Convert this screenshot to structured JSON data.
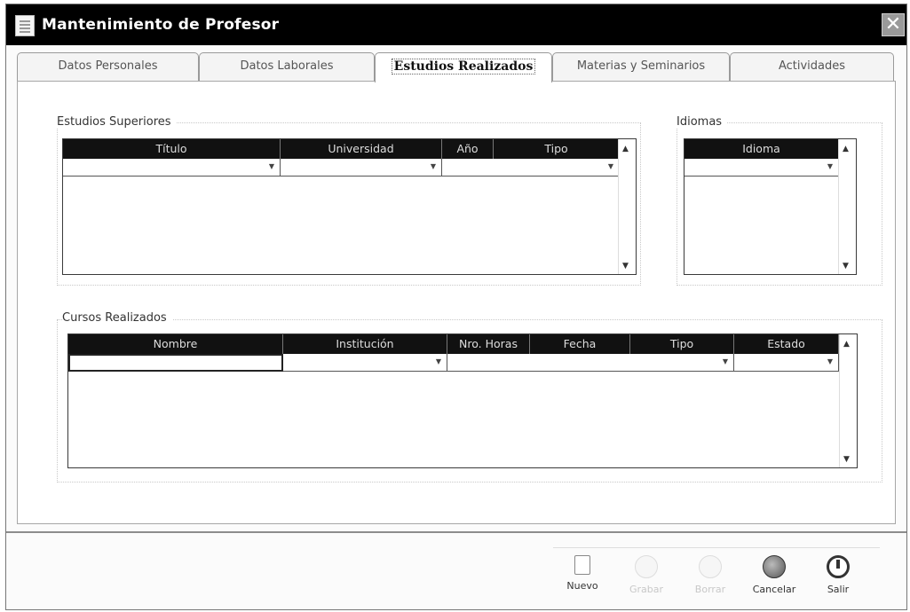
{
  "window": {
    "title": "Mantenimiento de Profesor",
    "close_symbol": "✕"
  },
  "tabs": [
    {
      "label": "Datos Personales",
      "active": false
    },
    {
      "label": "Datos Laborales",
      "active": false
    },
    {
      "label": "Estudios Realizados",
      "active": true
    },
    {
      "label": "Materias y Seminarios",
      "active": false
    },
    {
      "label": "Actividades",
      "active": false
    }
  ],
  "estudios": {
    "label": "Estudios Superiores",
    "columns": [
      "Título",
      "Universidad",
      "Año",
      "Tipo"
    ]
  },
  "idiomas": {
    "label": "Idiomas",
    "columns": [
      "Idioma"
    ]
  },
  "cursos": {
    "label": "Cursos Realizados",
    "columns": [
      "Nombre",
      "Institución",
      "Nro. Horas",
      "Fecha",
      "Tipo",
      "Estado"
    ]
  },
  "toolbar": {
    "nuevo": "Nuevo",
    "guardar": "Grabar",
    "borrar": "Borrar",
    "cancelar": "Cancelar",
    "salir": "Salir"
  },
  "icons": {
    "nuevo": "new-document-icon",
    "guardar": "save-icon",
    "borrar": "delete-icon",
    "cancelar": "cancel-icon",
    "salir": "power-icon"
  }
}
